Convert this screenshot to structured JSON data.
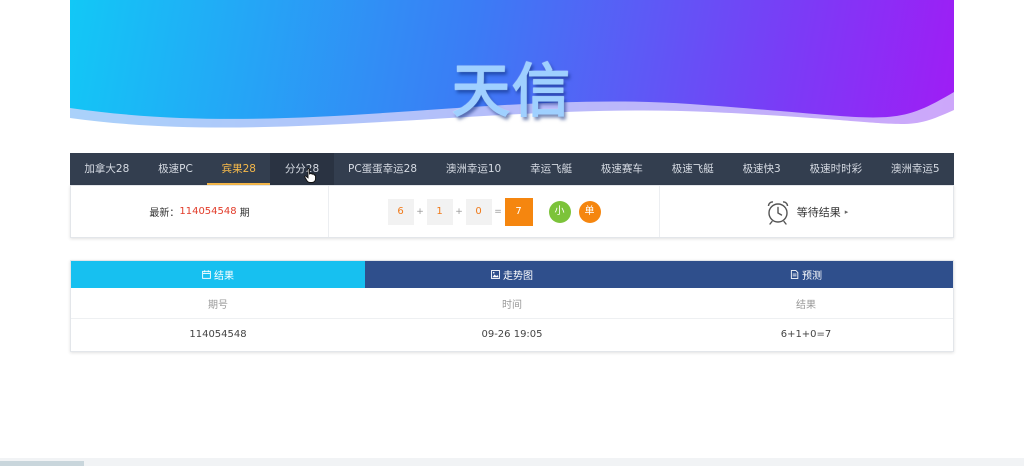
{
  "banner": {
    "title": "天信"
  },
  "nav": {
    "items": [
      {
        "label": "加拿大28"
      },
      {
        "label": "极速PC"
      },
      {
        "label": "宾果28"
      },
      {
        "label": "分分28"
      },
      {
        "label": "PC蛋蛋幸运28"
      },
      {
        "label": "澳洲幸运10"
      },
      {
        "label": "幸运飞艇"
      },
      {
        "label": "极速赛车"
      },
      {
        "label": "极速飞艇"
      },
      {
        "label": "极速快3"
      },
      {
        "label": "极速时时彩"
      },
      {
        "label": "澳洲幸运5"
      }
    ],
    "active_index": 2
  },
  "latest": {
    "prefix": "最新：",
    "issue": "114054548",
    "suffix": "期",
    "balls": [
      "6",
      "1",
      "0"
    ],
    "plus": "+",
    "equals": "=",
    "sum": "7",
    "size_tag": "小",
    "parity_tag": "单",
    "waiting": "等待结果",
    "waiting_arrow": "▸"
  },
  "colors": {
    "nav_bg": "#333e4f",
    "active": "#f5b84a",
    "tab_active": "#17c0f0",
    "tab_bg": "#2f4f8c",
    "orange": "#f5860f",
    "green": "#7cc33a",
    "red": "#e23c2a"
  },
  "panel": {
    "tabs": [
      {
        "label": "结果",
        "icon": "calendar-icon"
      },
      {
        "label": "走势图",
        "icon": "image-icon"
      },
      {
        "label": "预测",
        "icon": "document-icon"
      }
    ],
    "headers": [
      "期号",
      "时间",
      "结果"
    ],
    "rows": [
      [
        "114054548",
        "09-26 19:05",
        "6+1+0=7"
      ]
    ]
  }
}
